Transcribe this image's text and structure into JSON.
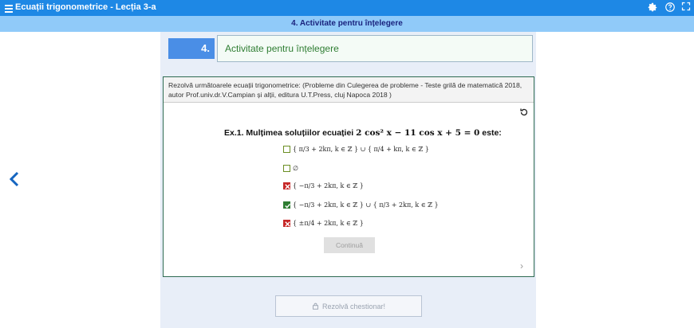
{
  "header": {
    "title": "Ecuații trigonometrice - Lecția 3-a",
    "subtitle": "4. Activitate pentru înțelegere",
    "settings_icon": "gear-icon",
    "help_icon": "help-icon",
    "fullscreen_icon": "fullscreen-icon"
  },
  "activity": {
    "number": "4.",
    "title": "Activitate pentru înțelegere"
  },
  "card": {
    "instructions": "Rezolvă următoarele ecuații trigonometrice: (Probleme din Culegerea de probleme - Teste grilă de matematică 2018, autor Prof.univ.dr.V.Campian și alții, editura U.T.Press, cluj Napoca 2018 )",
    "exercise_label": "Ex.1. Mulțimea soluțiilor ecuației",
    "equation": "2 cos² x − 11 cos x + 5 = 0",
    "exercise_suffix": "este:",
    "options": [
      {
        "state": "unchecked",
        "text": "{ π/3 + 2kπ, k ∈ ℤ } ∪ { π/4 + kπ, k ∈ ℤ }"
      },
      {
        "state": "unchecked",
        "text": "∅"
      },
      {
        "state": "wrong",
        "text": "{ −π/3 + 2kπ, k ∈ ℤ }"
      },
      {
        "state": "correct",
        "text": "{ −π/3 + 2kπ, k ∈ ℤ } ∪ { π/3 + 2kπ, k ∈ ℤ }"
      },
      {
        "state": "wrong",
        "text": "{ ±π/4 + 2kπ, k ∈ ℤ }"
      }
    ],
    "continue_label": "Continuă"
  },
  "footer": {
    "resolve_label": "Rezolvă chestionar!"
  },
  "colors": {
    "topbar": "#1e88e5",
    "subbar": "#90caf9",
    "accent": "#4a8ee6",
    "correct": "#2e7d32",
    "wrong": "#c62828"
  }
}
